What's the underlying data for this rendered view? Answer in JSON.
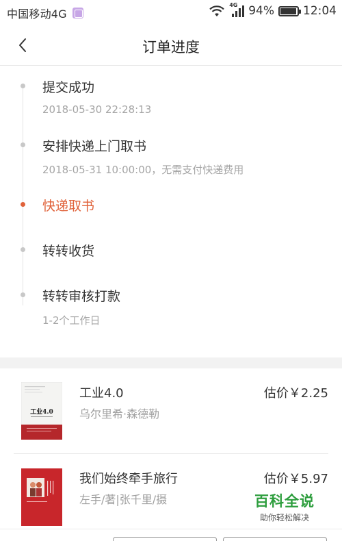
{
  "status_bar": {
    "carrier": "中国移动4G",
    "network": "4G",
    "battery": "94%",
    "battery_level": 0.94,
    "time": "12:04"
  },
  "nav": {
    "title": "订单进度",
    "back_icon": "chevron-left-icon"
  },
  "timeline": [
    {
      "title": "提交成功",
      "subtitle": "2018-05-30 22:28:13",
      "active": false
    },
    {
      "title": "安排快递上门取书",
      "subtitle": "2018-05-31 10:00:00，无需支付快递费用",
      "active": false
    },
    {
      "title": "快递取书",
      "subtitle": "",
      "active": true
    },
    {
      "title": "转转收货",
      "subtitle": "",
      "active": false
    },
    {
      "title": "转转审核打款",
      "subtitle": "1-2个工作日",
      "active": false
    }
  ],
  "colors": {
    "accent": "#e0623a",
    "muted_dot": "#c8c8c8",
    "watermark_green": "#2e9e3e"
  },
  "products": [
    {
      "name": "工业4.0",
      "author": "乌尔里希·森德勒",
      "price": "估价￥2.25",
      "cover_title": "工业4.0"
    },
    {
      "name": "我们始终牵手旅行",
      "author": "左手/著|张千里/摄",
      "price": "估价￥5.97"
    }
  ],
  "watermark": {
    "main": "百科全说",
    "sub": "助你轻松解决"
  }
}
